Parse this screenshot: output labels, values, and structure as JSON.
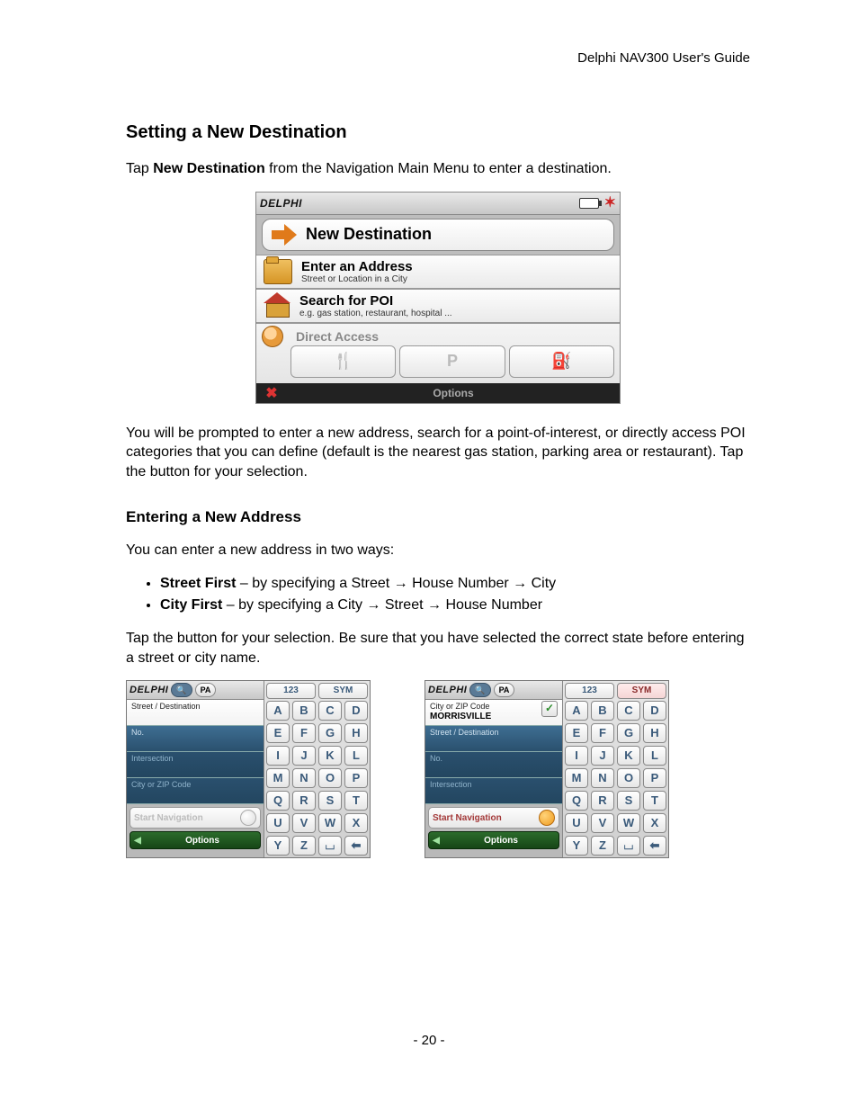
{
  "header_right": "Delphi NAV300 User's Guide",
  "section_title": "Setting a New Destination",
  "intro_prefix": "Tap ",
  "intro_bold": "New Destination",
  "intro_suffix": " from the Navigation Main Menu to enter a destination.",
  "device1": {
    "brand": "DELPHI",
    "title": "New Destination",
    "row1_title": "Enter an Address",
    "row1_sub": "Street or Location in a City",
    "row2_title": "Search for POI",
    "row2_sub": "e.g. gas station, restaurant, hospital ...",
    "da_label": "Direct Access",
    "da_btn1": "🍴",
    "da_btn2": "P",
    "da_btn3": "⛽",
    "bottom_options": "Options"
  },
  "para2": "You will be prompted to enter a new address, search for a point-of-interest, or directly access POI categories that you can define (default is the nearest gas station, parking area or restaurant).  Tap the button for your selection.",
  "subsection_title": "Entering a New Address",
  "para3": "You can enter a new address in two ways:",
  "bullet1_bold": "Street First",
  "bullet1_rest": " – by specifying a Street → House Number → City",
  "bullet2_bold": "City First",
  "bullet2_rest": " – by specifying a City → Street → House Number",
  "para4": "Tap the button for your selection.  Be sure that you have selected the correct state before entering a street or city name.",
  "mini_common": {
    "brand": "DELPHI",
    "state": "PA",
    "tabs_123": "123",
    "tabs_sym": "SYM",
    "keys": [
      "A",
      "B",
      "C",
      "D",
      "E",
      "F",
      "G",
      "H",
      "I",
      "J",
      "K",
      "L",
      "M",
      "N",
      "O",
      "P",
      "Q",
      "R",
      "S",
      "T",
      "U",
      "V",
      "W",
      "X",
      "Y",
      "Z"
    ],
    "start_label": "Start Navigation",
    "options": "Options"
  },
  "mini1": {
    "f1": "Street / Destination",
    "f2": "No.",
    "f3": "Intersection",
    "f4": "City or ZIP Code"
  },
  "mini2": {
    "f1_label": "City or ZIP Code",
    "f1_value": "MORRISVILLE",
    "f2": "Street / Destination",
    "f3": "No.",
    "f4": "Intersection"
  },
  "page_number": "- 20 -"
}
